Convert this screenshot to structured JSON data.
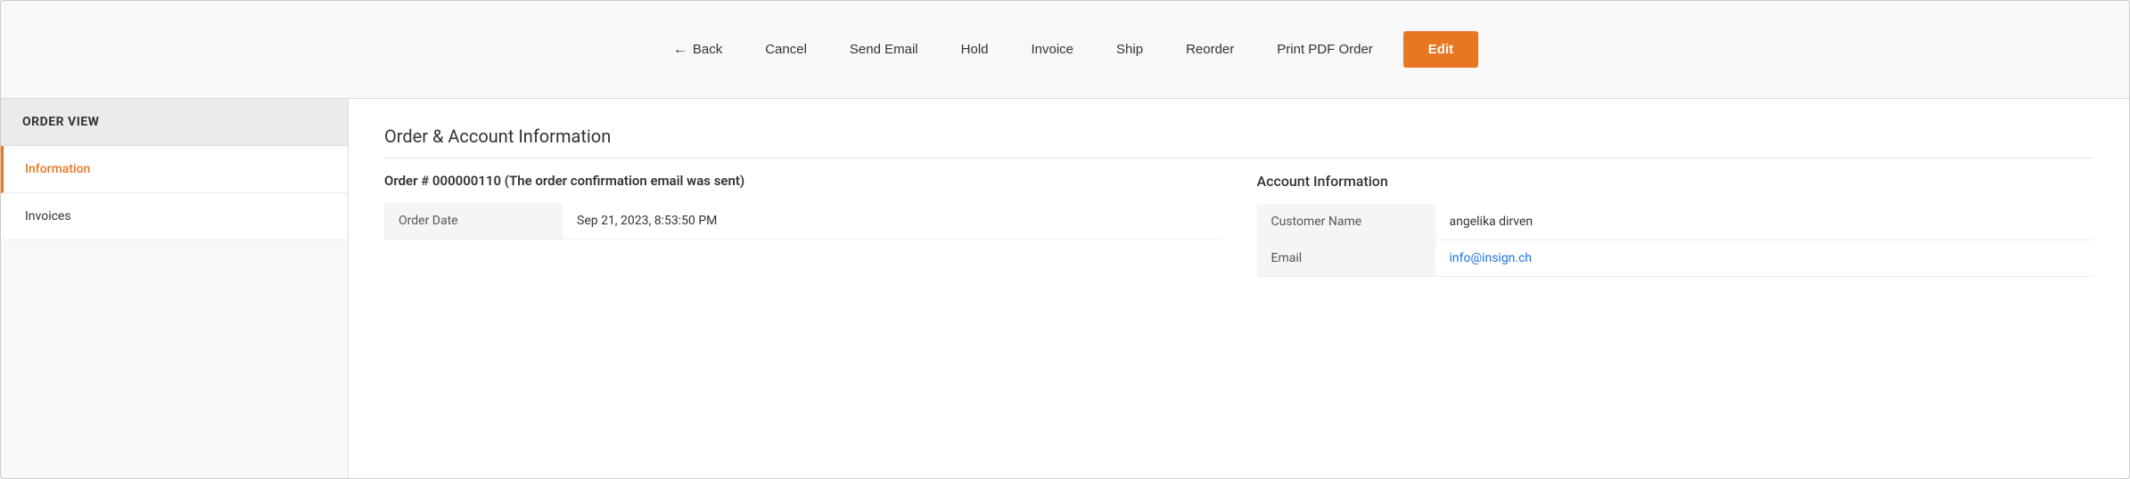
{
  "toolbar": {
    "back_label": "Back",
    "cancel_label": "Cancel",
    "send_email_label": "Send Email",
    "hold_label": "Hold",
    "invoice_label": "Invoice",
    "ship_label": "Ship",
    "reorder_label": "Reorder",
    "print_pdf_label": "Print PDF Order",
    "edit_label": "Edit"
  },
  "sidebar": {
    "header": "ORDER VIEW",
    "items": [
      {
        "label": "Information",
        "active": true
      },
      {
        "label": "Invoices",
        "active": false
      }
    ]
  },
  "content": {
    "section_title": "Order & Account Information",
    "order_section": {
      "title": "Order # 000000110 (The order confirmation email was sent)",
      "fields": [
        {
          "label": "Order Date",
          "value": "Sep 21, 2023, 8:53:50 PM"
        }
      ]
    },
    "account_section": {
      "title": "Account Information",
      "fields": [
        {
          "label": "Customer Name",
          "value": "angelika dirven",
          "type": "text"
        },
        {
          "label": "Email",
          "value": "info@insign.ch",
          "type": "email"
        }
      ]
    }
  },
  "colors": {
    "accent": "#e87722",
    "link": "#1a73e8"
  }
}
